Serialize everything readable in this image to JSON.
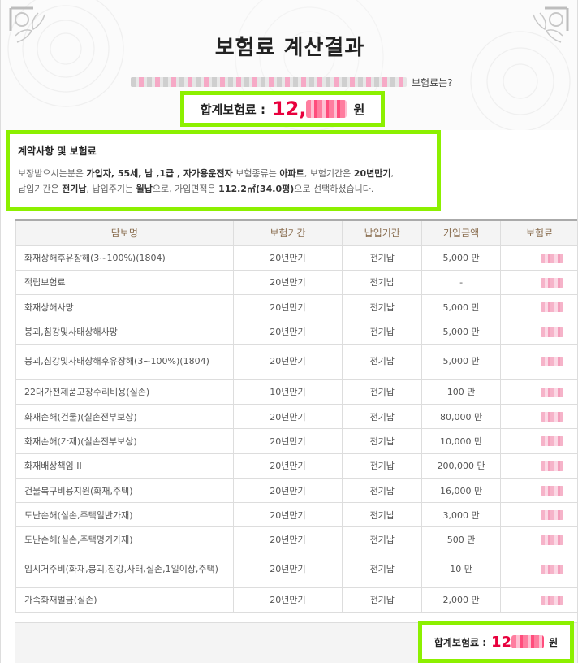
{
  "page": {
    "title": "보험료 계산결과",
    "subtitle_suffix": "보험료는?"
  },
  "total_top": {
    "label": "합계보험료 :",
    "value_prefix": "12,",
    "unit": "원"
  },
  "contract": {
    "heading": "계약사항 및 보험료",
    "line1_a": "보장받으시는분은 ",
    "line1_b": "가입자, 55세, 남 ,1급 , 자가용운전자",
    "line1_c": " 보험종류는 ",
    "line1_d": "아파트",
    "line1_e": ", 보험기간은 ",
    "line1_f": "20년만기",
    "line1_g": ",",
    "line2_a": "납입기간은 ",
    "line2_b": "전기납",
    "line2_c": ", 납입주기는 ",
    "line2_d": "월납",
    "line2_e": "으로, 가입면적은 ",
    "line2_f": "112.2㎡(34.0평)",
    "line2_g": "으로 선택하셨습니다."
  },
  "table": {
    "headers": [
      "담보명",
      "보험기간",
      "납입기간",
      "가입금액",
      "보험료"
    ],
    "rows": [
      {
        "name": "화재상해후유장해(3~100%)(1804)",
        "term": "20년만기",
        "pay": "전기납",
        "amount": "5,000 만"
      },
      {
        "name": "적립보험료",
        "term": "20년만기",
        "pay": "전기납",
        "amount": "-"
      },
      {
        "name": "화재상해사망",
        "term": "20년만기",
        "pay": "전기납",
        "amount": "5,000 만"
      },
      {
        "name": "붕괴,침강및사태상해사망",
        "term": "20년만기",
        "pay": "전기납",
        "amount": "5,000 만"
      },
      {
        "name": "붕괴,침강및사태상해후유장해(3~100%)(1804)",
        "term": "20년만기",
        "pay": "전기납",
        "amount": "5,000 만"
      },
      {
        "name": "22대가전제품고장수리비용(실손)",
        "term": "10년만기",
        "pay": "전기납",
        "amount": "100 만"
      },
      {
        "name": "화재손해(건물)(실손전부보상)",
        "term": "20년만기",
        "pay": "전기납",
        "amount": "80,000 만"
      },
      {
        "name": "화재손해(가재)(실손전부보상)",
        "term": "20년만기",
        "pay": "전기납",
        "amount": "10,000 만"
      },
      {
        "name": "화재배상책임 II",
        "term": "20년만기",
        "pay": "전기납",
        "amount": "200,000 만"
      },
      {
        "name": "건물복구비용지원(화재,주택)",
        "term": "20년만기",
        "pay": "전기납",
        "amount": "16,000 만"
      },
      {
        "name": "도난손해(실손,주택일반가재)",
        "term": "20년만기",
        "pay": "전기납",
        "amount": "3,000 만"
      },
      {
        "name": "도난손해(실손,주택명기가재)",
        "term": "20년만기",
        "pay": "전기납",
        "amount": "500 만"
      },
      {
        "name": "임시거주비(화재,붕괴,침강,사태,실손,1일이상,주택)",
        "term": "20년만기",
        "pay": "전기납",
        "amount": "10 만"
      },
      {
        "name": "가족화재벌금(실손)",
        "term": "20년만기",
        "pay": "전기납",
        "amount": "2,000 만"
      }
    ]
  },
  "total_bottom": {
    "label": "합계보험료 :",
    "value_prefix": "12",
    "unit": "원"
  },
  "colors": {
    "highlight": "#8cf000",
    "total_red": "#e8003d",
    "header_text": "#8a6e50"
  }
}
